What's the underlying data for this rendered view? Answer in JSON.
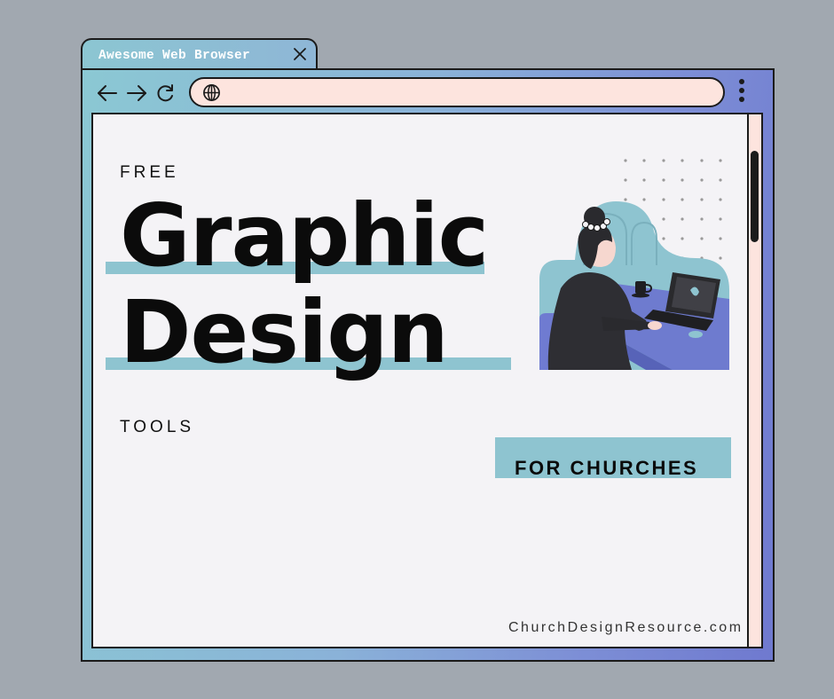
{
  "browser": {
    "tab_title": "Awesome Web Browser",
    "address": {
      "value": "",
      "placeholder": ""
    },
    "icons": {
      "tab_close": "close-icon",
      "back": "arrow-left-icon",
      "forward": "arrow-right-icon",
      "reload": "reload-icon",
      "site": "globe-icon",
      "menu": "vertical-dots-menu-icon"
    },
    "colors": {
      "frame_start": "#8bc8d3",
      "frame_end": "#6f79cf",
      "address_bar": "#fde4de",
      "page_background": "#f4f3f6",
      "accent": "#8ec4d0"
    }
  },
  "page": {
    "headline": {
      "kicker": "FREE",
      "line1": "Graphic",
      "line2": "Design",
      "suffix": "TOOLS"
    },
    "badge": "FOR CHURCHES",
    "site_url": "ChurchDesignResource.com",
    "illustration": "person-working-at-laptop-illustration"
  }
}
